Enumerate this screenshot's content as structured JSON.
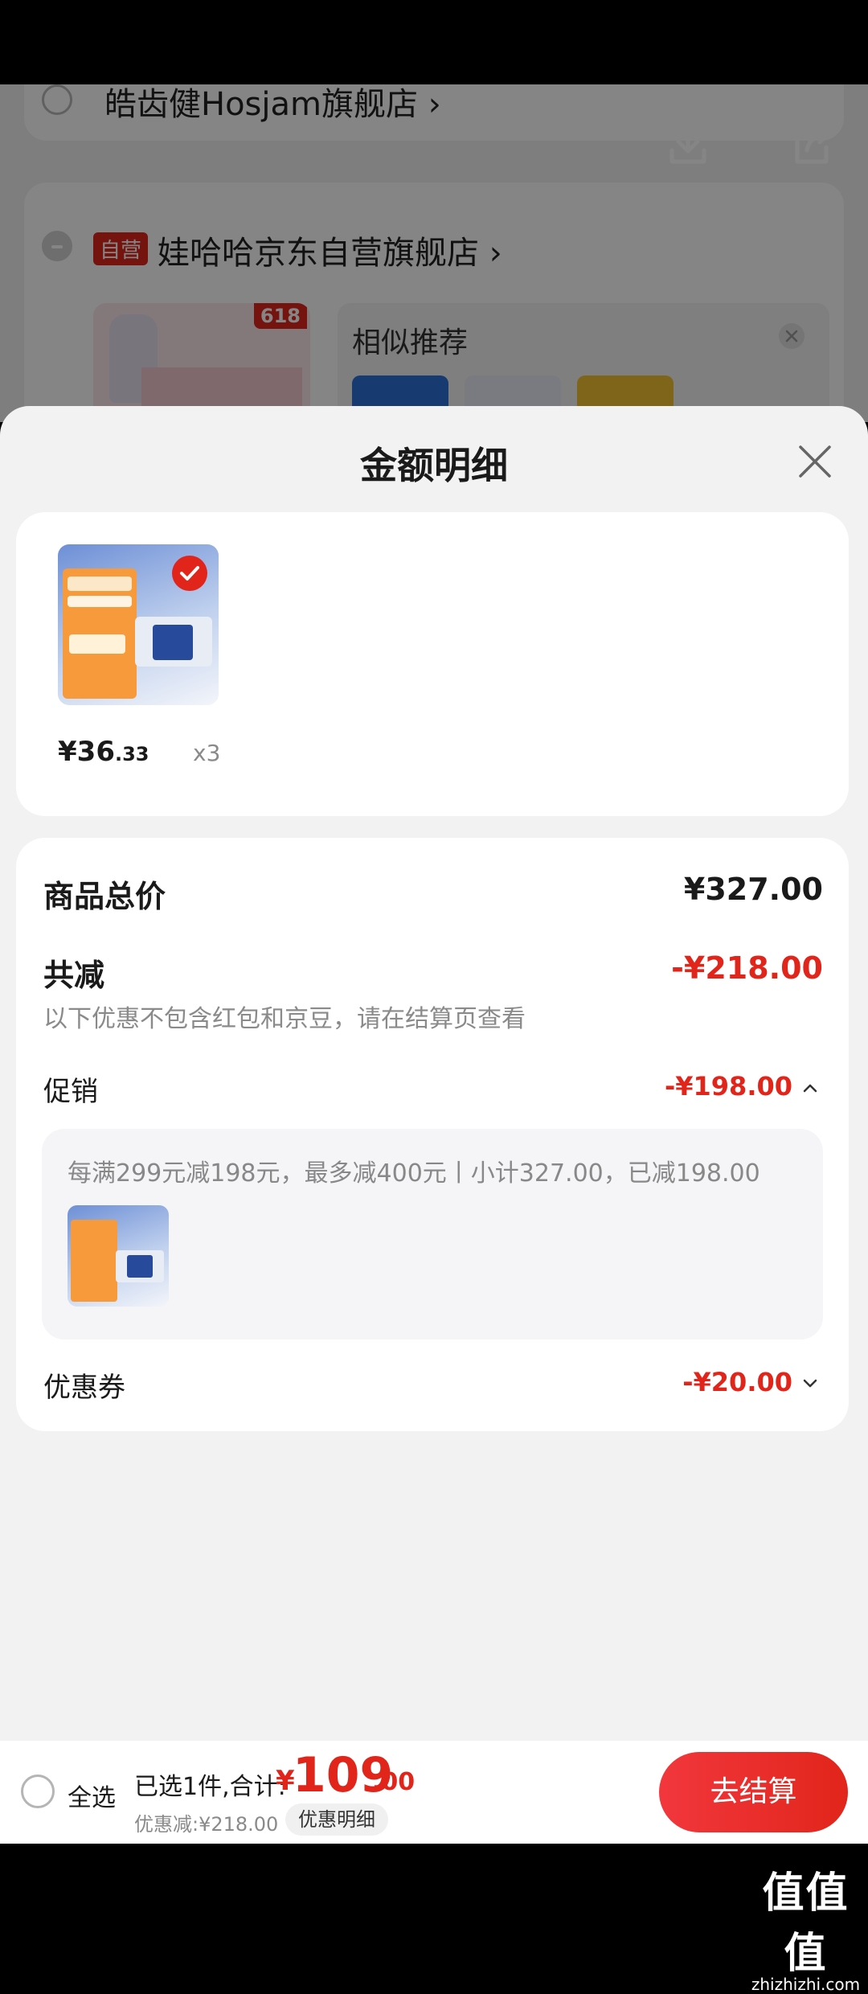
{
  "background": {
    "store1_name": "皓齿健Hosjam旗舰店 ›",
    "store2_tag": "自营",
    "store2_name": "娃哈哈京东自营旗舰店 ›",
    "badge_618": "618",
    "similar_title": "相似推荐",
    "icons": [
      "download-icon",
      "share-icon",
      "close-icon"
    ]
  },
  "sheet": {
    "title": "金额明细",
    "product": {
      "price_main": "¥36",
      "price_cents": ".33",
      "qty": "x3"
    },
    "summary": {
      "total_label": "商品总价",
      "total_value": "¥327.00",
      "reduce_label": "共减",
      "reduce_value": "-¥218.00",
      "reduce_note": "以下优惠不包含红包和京豆，请在结算页查看",
      "promo_label": "促销",
      "promo_value": "-¥198.00",
      "promo_rule": "每满299元减198元，最多减400元丨小计327.00，已减198.00",
      "coupon_label": "优惠券",
      "coupon_value": "-¥20.00"
    }
  },
  "bottom_bar": {
    "select_all": "全选",
    "selected_text": "已选1件,合计:",
    "total_yen": "¥",
    "total_int": "109",
    "total_dec": ".00",
    "discount_text": "优惠减:¥218.00",
    "detail_button": "优惠明细",
    "checkout_button": "去结算"
  },
  "watermark": {
    "big": "值值值",
    "small": "zhizhizhi.com"
  },
  "colors": {
    "accent": "#e1251b",
    "sheet_bg": "#f2f2f2",
    "card_bg": "#ffffff"
  }
}
